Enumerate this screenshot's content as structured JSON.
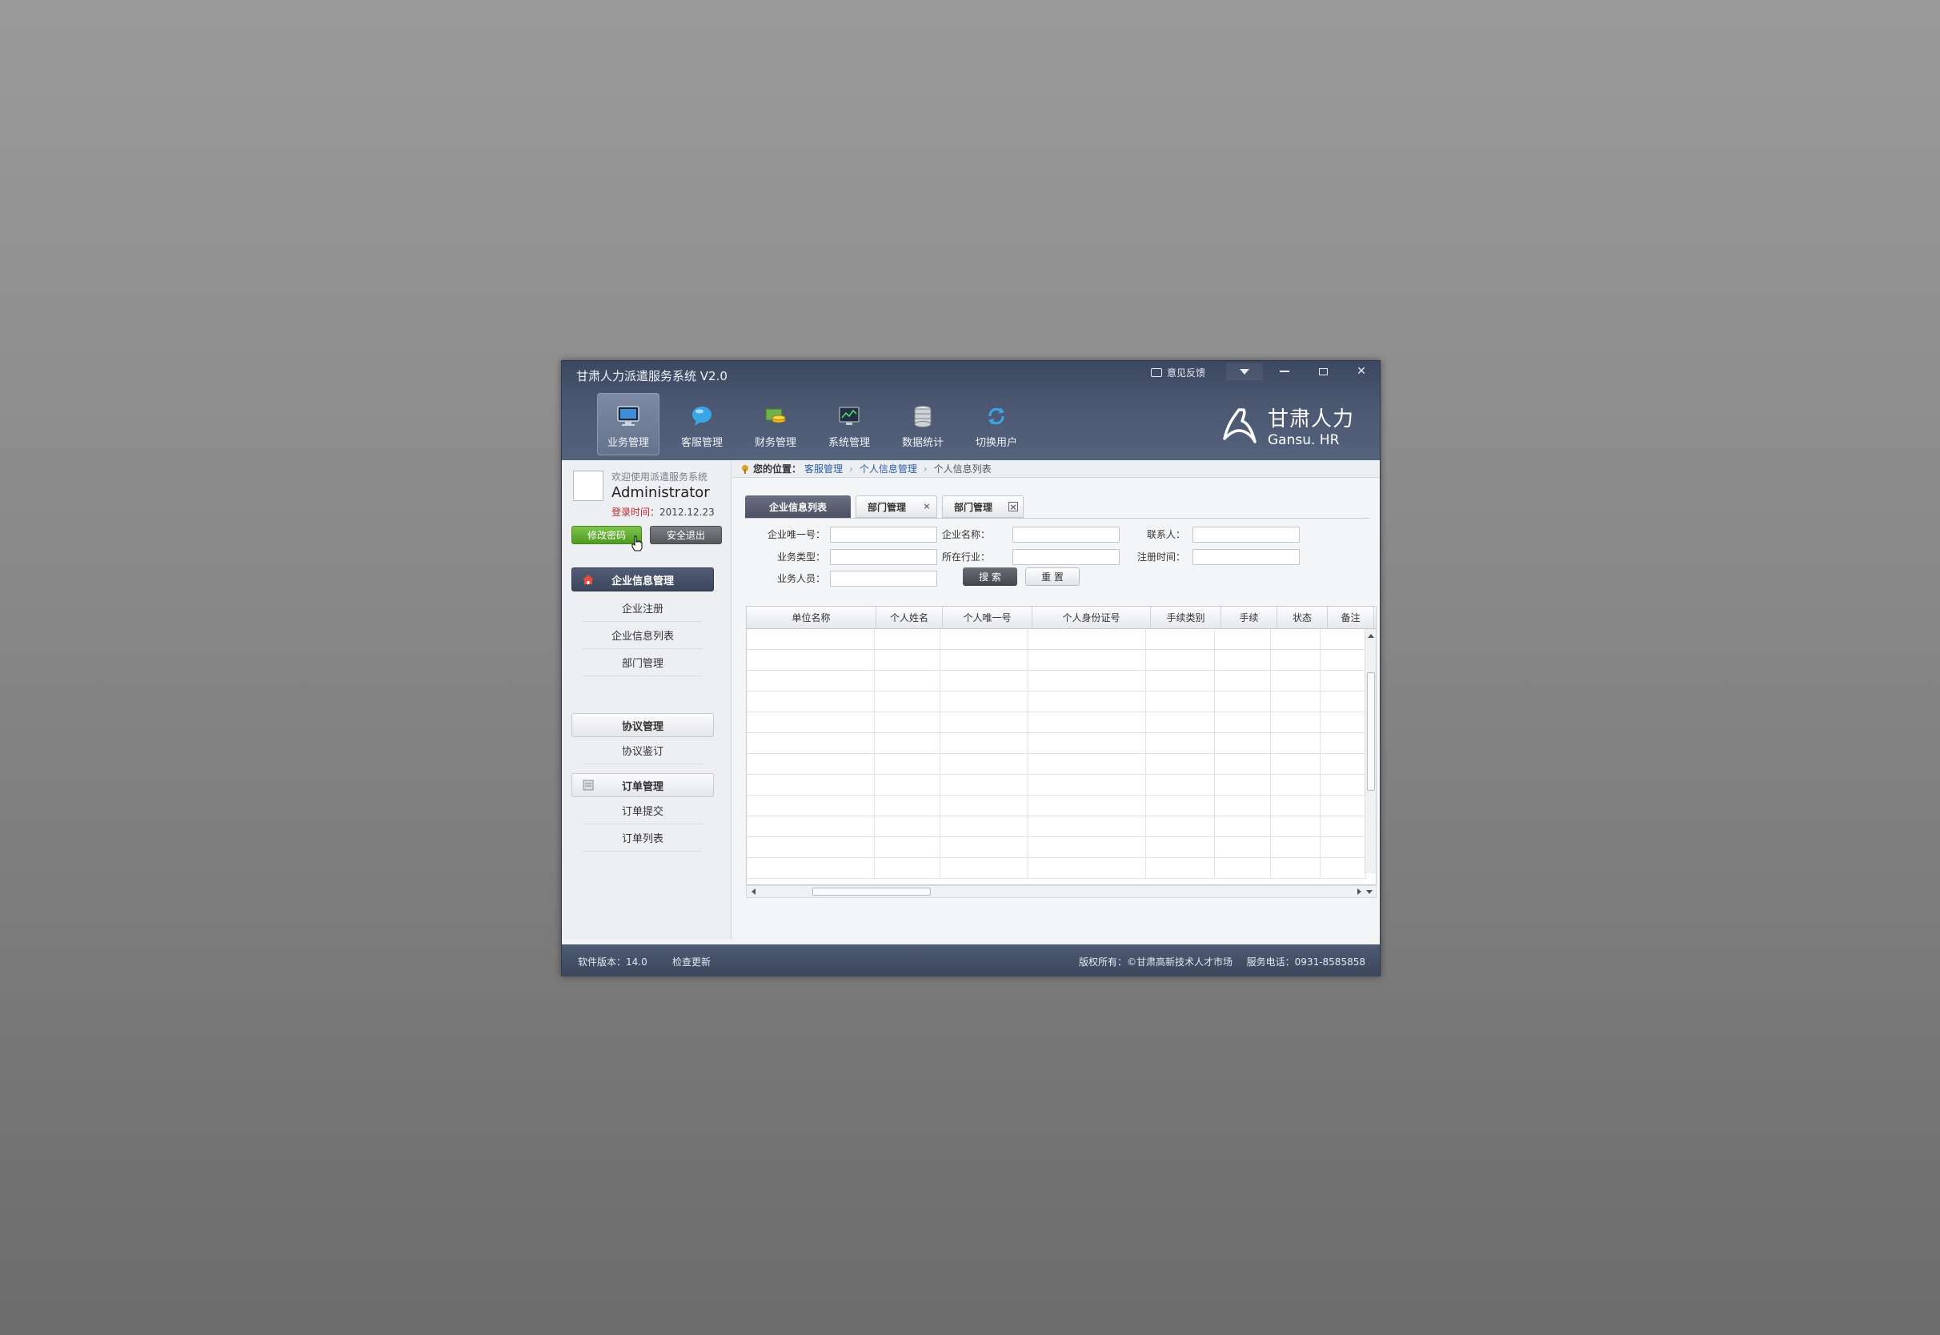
{
  "window": {
    "title": "甘肃人力派遣服务系统  V2.0",
    "feedback_label": "意见反馈"
  },
  "nav": [
    {
      "label": "业务管理",
      "icon": "monitor-icon",
      "active": true
    },
    {
      "label": "客服管理",
      "icon": "chat-bubble-icon"
    },
    {
      "label": "财务管理",
      "icon": "finance-coins-icon"
    },
    {
      "label": "系统管理",
      "icon": "system-screen-icon"
    },
    {
      "label": "数据统计",
      "icon": "database-icon"
    },
    {
      "label": "切换用户",
      "icon": "switch-user-icon"
    }
  ],
  "logo": {
    "cn": "甘肃人力",
    "en": "Gansu. HR"
  },
  "user": {
    "welcome": "欢迎使用派遣服务系统",
    "name": "Administrator",
    "login_label": "登录时间：",
    "login_time": "2012.12.23",
    "change_pwd": "修改密码",
    "logout": "安全退出"
  },
  "sidebar": {
    "groups": [
      {
        "title": "企业信息管理",
        "items": [
          "企业注册",
          "企业信息列表",
          "部门管理"
        ]
      },
      {
        "title": "协议管理",
        "items": [
          "协议鉴订"
        ]
      },
      {
        "title": "订单管理",
        "items": [
          "订单提交",
          "订单列表"
        ]
      }
    ]
  },
  "breadcrumb": {
    "label": "您的位置：",
    "items": [
      "客服管理",
      "个人信息管理",
      "个人信息列表"
    ]
  },
  "tabs": [
    {
      "label": "企业信息列表",
      "active": true
    },
    {
      "label": "部门管理",
      "close": "×"
    },
    {
      "label": "部门管理",
      "close": "×"
    }
  ],
  "form": {
    "fields": [
      {
        "label": "企业唯一号："
      },
      {
        "label": "企业名称："
      },
      {
        "label": "联系人："
      },
      {
        "label": "业务类型："
      },
      {
        "label": "所在行业："
      },
      {
        "label": "注册时间："
      },
      {
        "label": "业务人员："
      }
    ],
    "search_btn": "搜 索",
    "reset_btn": "重 置"
  },
  "table": {
    "columns": [
      "单位名称",
      "个人姓名",
      "个人唯一号",
      "个人身份证号",
      "手续类别",
      "手续",
      "状态",
      "备注"
    ],
    "rows": []
  },
  "footer": {
    "version": "软件版本：14.0",
    "update": "检查更新",
    "copyright": "版权所有：©甘肃高新技术人才市场",
    "phone": "服务电话：0931-8585858"
  },
  "colors": {
    "header_bg": "#4c5872",
    "active_green": "#5fa82c",
    "accent_blue": "#2b5fa8",
    "login_red": "#c0262d"
  }
}
